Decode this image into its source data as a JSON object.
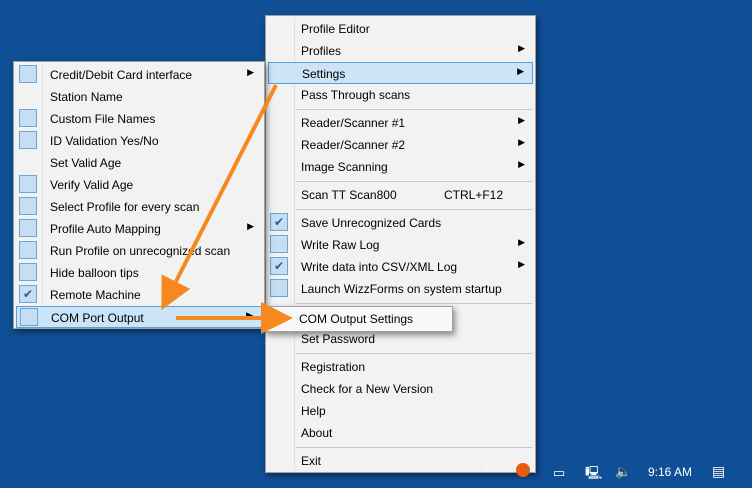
{
  "main_menu": {
    "items": [
      {
        "label": "Profile Editor",
        "arrow": false,
        "check": "none"
      },
      {
        "label": "Profiles",
        "arrow": true,
        "check": "none"
      },
      {
        "label": "Settings",
        "arrow": true,
        "check": "none",
        "highlight": true
      },
      {
        "label": "Pass Through scans",
        "arrow": false,
        "check": "none"
      },
      {
        "label": "Reader/Scanner #1",
        "arrow": true,
        "check": "none"
      },
      {
        "label": "Reader/Scanner #2",
        "arrow": true,
        "check": "none"
      },
      {
        "label": "Image Scanning",
        "arrow": true,
        "check": "none"
      },
      {
        "label": "Scan TT Scan800",
        "shortcut": "CTRL+F12",
        "arrow": false,
        "check": "none"
      },
      {
        "label": "Save Unrecognized Cards",
        "arrow": false,
        "check": "checked"
      },
      {
        "label": "Write Raw Log",
        "arrow": true,
        "check": "box"
      },
      {
        "label": "Write data into CSV/XML Log",
        "arrow": true,
        "check": "checked"
      },
      {
        "label": "Launch WizzForms on system startup",
        "arrow": false,
        "check": "box"
      },
      {
        "label": "Set Password",
        "arrow": false,
        "check": "none"
      },
      {
        "label": "Registration",
        "arrow": false,
        "check": "none"
      },
      {
        "label": "Check for a New Version",
        "arrow": false,
        "check": "none"
      },
      {
        "label": "Help",
        "arrow": false,
        "check": "none"
      },
      {
        "label": "About",
        "arrow": false,
        "check": "none"
      },
      {
        "label": "Exit",
        "arrow": false,
        "check": "none"
      }
    ]
  },
  "settings_menu": {
    "items": [
      {
        "label": "Credit/Debit Card interface",
        "arrow": true,
        "check": "box"
      },
      {
        "label": "Station Name",
        "arrow": false,
        "check": "none"
      },
      {
        "label": "Custom File Names",
        "arrow": false,
        "check": "box"
      },
      {
        "label": "ID Validation Yes/No",
        "arrow": false,
        "check": "box"
      },
      {
        "label": "Set Valid Age",
        "arrow": false,
        "check": "none"
      },
      {
        "label": "Verify Valid Age",
        "arrow": false,
        "check": "box"
      },
      {
        "label": "Select Profile for every scan",
        "arrow": false,
        "check": "box"
      },
      {
        "label": "Profile Auto Mapping",
        "arrow": true,
        "check": "box"
      },
      {
        "label": "Run Profile on unrecognized scan",
        "arrow": false,
        "check": "box"
      },
      {
        "label": "Hide balloon tips",
        "arrow": false,
        "check": "box"
      },
      {
        "label": "Remote Machine",
        "arrow": false,
        "check": "checked"
      },
      {
        "label": "COM Port Output",
        "arrow": true,
        "check": "box",
        "highlight": true
      }
    ]
  },
  "com_submenu": {
    "items": [
      {
        "label": "COM Output Settings"
      }
    ]
  },
  "taskbar": {
    "time": "9:16 AM"
  },
  "colors": {
    "desktop": "#0f4f96",
    "highlight": "#cce4f7",
    "arrow": "#f5891f"
  }
}
